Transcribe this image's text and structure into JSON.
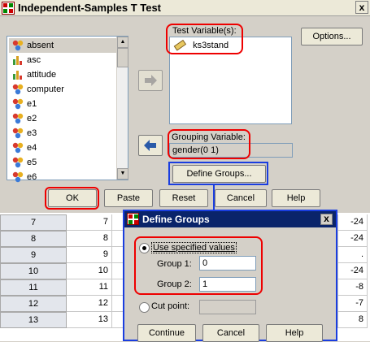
{
  "window": {
    "title": "Independent-Samples T Test",
    "close_glyph": "x"
  },
  "variables": {
    "items": [
      {
        "label": "absent",
        "icon": "nominal-icon",
        "selected": true
      },
      {
        "label": "asc",
        "icon": "scale-icon"
      },
      {
        "label": "attitude",
        "icon": "scale-icon"
      },
      {
        "label": "computer",
        "icon": "nominal-icon"
      },
      {
        "label": "e1",
        "icon": "nominal-icon"
      },
      {
        "label": "e2",
        "icon": "nominal-icon"
      },
      {
        "label": "e3",
        "icon": "nominal-icon"
      },
      {
        "label": "e4",
        "icon": "nominal-icon"
      },
      {
        "label": "e5",
        "icon": "nominal-icon"
      },
      {
        "label": "e6",
        "icon": "nominal-icon"
      }
    ]
  },
  "test_variables": {
    "label": "Test Variable(s):",
    "items": [
      "ks3stand"
    ]
  },
  "grouping": {
    "label": "Grouping Variable:",
    "value": "gender(0 1)"
  },
  "buttons": {
    "options": "Options...",
    "define_groups": "Define Groups...",
    "ok": "OK",
    "paste": "Paste",
    "reset": "Reset",
    "cancel": "Cancel",
    "help": "Help"
  },
  "data_rows": [
    {
      "row": "7",
      "c1": "7",
      "c2": "-24"
    },
    {
      "row": "8",
      "c1": "8",
      "c2": "-24"
    },
    {
      "row": "9",
      "c1": "9",
      "c2": "."
    },
    {
      "row": "10",
      "c1": "10",
      "c2": "-24"
    },
    {
      "row": "11",
      "c1": "11",
      "c2": "-8"
    },
    {
      "row": "12",
      "c1": "12",
      "c2": "-7"
    },
    {
      "row": "13",
      "c1": "13",
      "c2": "8"
    }
  ],
  "define_groups": {
    "title": "Define Groups",
    "close_glyph": "x",
    "use_specified": "Use specified values",
    "group1_label": "Group 1:",
    "group1_value": "0",
    "group2_label": "Group 2:",
    "group2_value": "1",
    "cut_point": "Cut point:",
    "cut_value": "",
    "continue": "Continue",
    "cancel": "Cancel",
    "help": "Help"
  },
  "colors": {
    "highlight_red": "#e00000",
    "highlight_blue": "#1a3ee0",
    "title_blue": "#0a246a"
  }
}
